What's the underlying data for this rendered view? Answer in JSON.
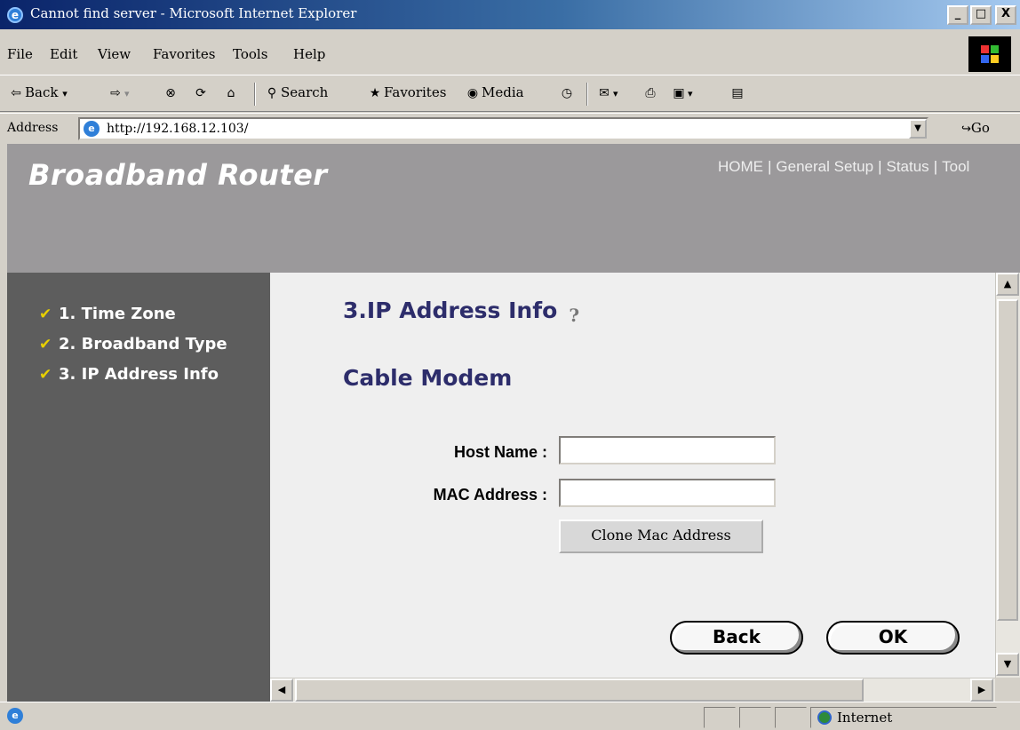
{
  "window": {
    "title": "Cannot find server - Microsoft Internet Explorer",
    "buttons": {
      "minimize": "_",
      "maximize": "□",
      "close": "X"
    }
  },
  "menu": {
    "items": [
      {
        "label": "File"
      },
      {
        "label": "Edit"
      },
      {
        "label": "View"
      },
      {
        "label": "Favorites"
      },
      {
        "label": "Tools"
      },
      {
        "label": "Help"
      }
    ]
  },
  "toolbar": {
    "back": "Back",
    "search": "Search",
    "favorites": "Favorites",
    "media": "Media"
  },
  "address": {
    "label": "Address",
    "url": "http://192.168.12.103/",
    "go": "Go"
  },
  "page": {
    "brand": "Broadband Router",
    "nav": [
      "HOME",
      "General Setup",
      "Status",
      "Tool"
    ],
    "sidebar": [
      {
        "label": "1. Time Zone"
      },
      {
        "label": "2. Broadband Type"
      },
      {
        "label": "3. IP Address Info"
      }
    ],
    "section_title": "3.IP Address Info",
    "subtitle": "Cable Modem",
    "form": {
      "host_name_label": "Host Name :",
      "host_name_value": "",
      "mac_label": "MAC Address :",
      "mac_value": "",
      "clone_button": "Clone Mac Address"
    },
    "back_button": "Back",
    "ok_button": "OK"
  },
  "status": {
    "zone": "Internet"
  },
  "colors": {
    "header_bg": "#9b999b",
    "sidebar_bg": "#5d5d5d",
    "heading": "#2d2d6b",
    "check": "#e8d000"
  },
  "icons": [
    "ie-icon",
    "back-icon",
    "forward-icon",
    "stop-icon",
    "refresh-icon",
    "home-icon",
    "search-icon",
    "favorites-icon",
    "media-icon",
    "history-icon",
    "mail-icon",
    "print-icon",
    "edit-icon",
    "discuss-icon",
    "help-icon",
    "checkmark-icon",
    "globe-icon"
  ]
}
